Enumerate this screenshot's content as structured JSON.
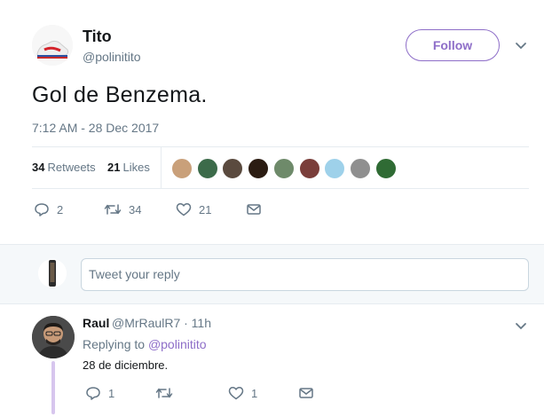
{
  "tweet": {
    "author_name": "Tito",
    "author_handle": "@polinitito",
    "follow_label": "Follow",
    "text": "Gol de Benzema.",
    "timestamp": "7:12 AM - 28 Dec 2017",
    "retweets_count": "34",
    "retweets_label": "Retweets",
    "likes_count": "21",
    "likes_label": "Likes",
    "likers": [
      {
        "name": "liker-1",
        "color": "#c9a07a"
      },
      {
        "name": "liker-2",
        "color": "#3c6b4a"
      },
      {
        "name": "liker-3",
        "color": "#5a4a3e"
      },
      {
        "name": "liker-4",
        "color": "#2b1c12"
      },
      {
        "name": "liker-5",
        "color": "#6e8a6a"
      },
      {
        "name": "liker-6",
        "color": "#7a3e3a"
      },
      {
        "name": "liker-7",
        "color": "#9ed1ea"
      },
      {
        "name": "liker-8",
        "color": "#8f8f8f"
      },
      {
        "name": "liker-9",
        "color": "#2f6b34"
      }
    ],
    "actions": {
      "reply_count": "2",
      "retweet_count": "34",
      "like_count": "21"
    }
  },
  "reply_box": {
    "placeholder": "Tweet your reply"
  },
  "reply": {
    "author_name": "Raul",
    "author_handle": "@MrRaulR7 · 11h",
    "replying_prefix": "Replying to",
    "replying_to": "@polinitito",
    "text": "28 de diciembre.",
    "actions": {
      "reply_count": "1",
      "like_count": "1"
    }
  },
  "colors": {
    "accent": "#8e6ec8",
    "muted": "#657786",
    "divider": "#e6ecf0"
  }
}
